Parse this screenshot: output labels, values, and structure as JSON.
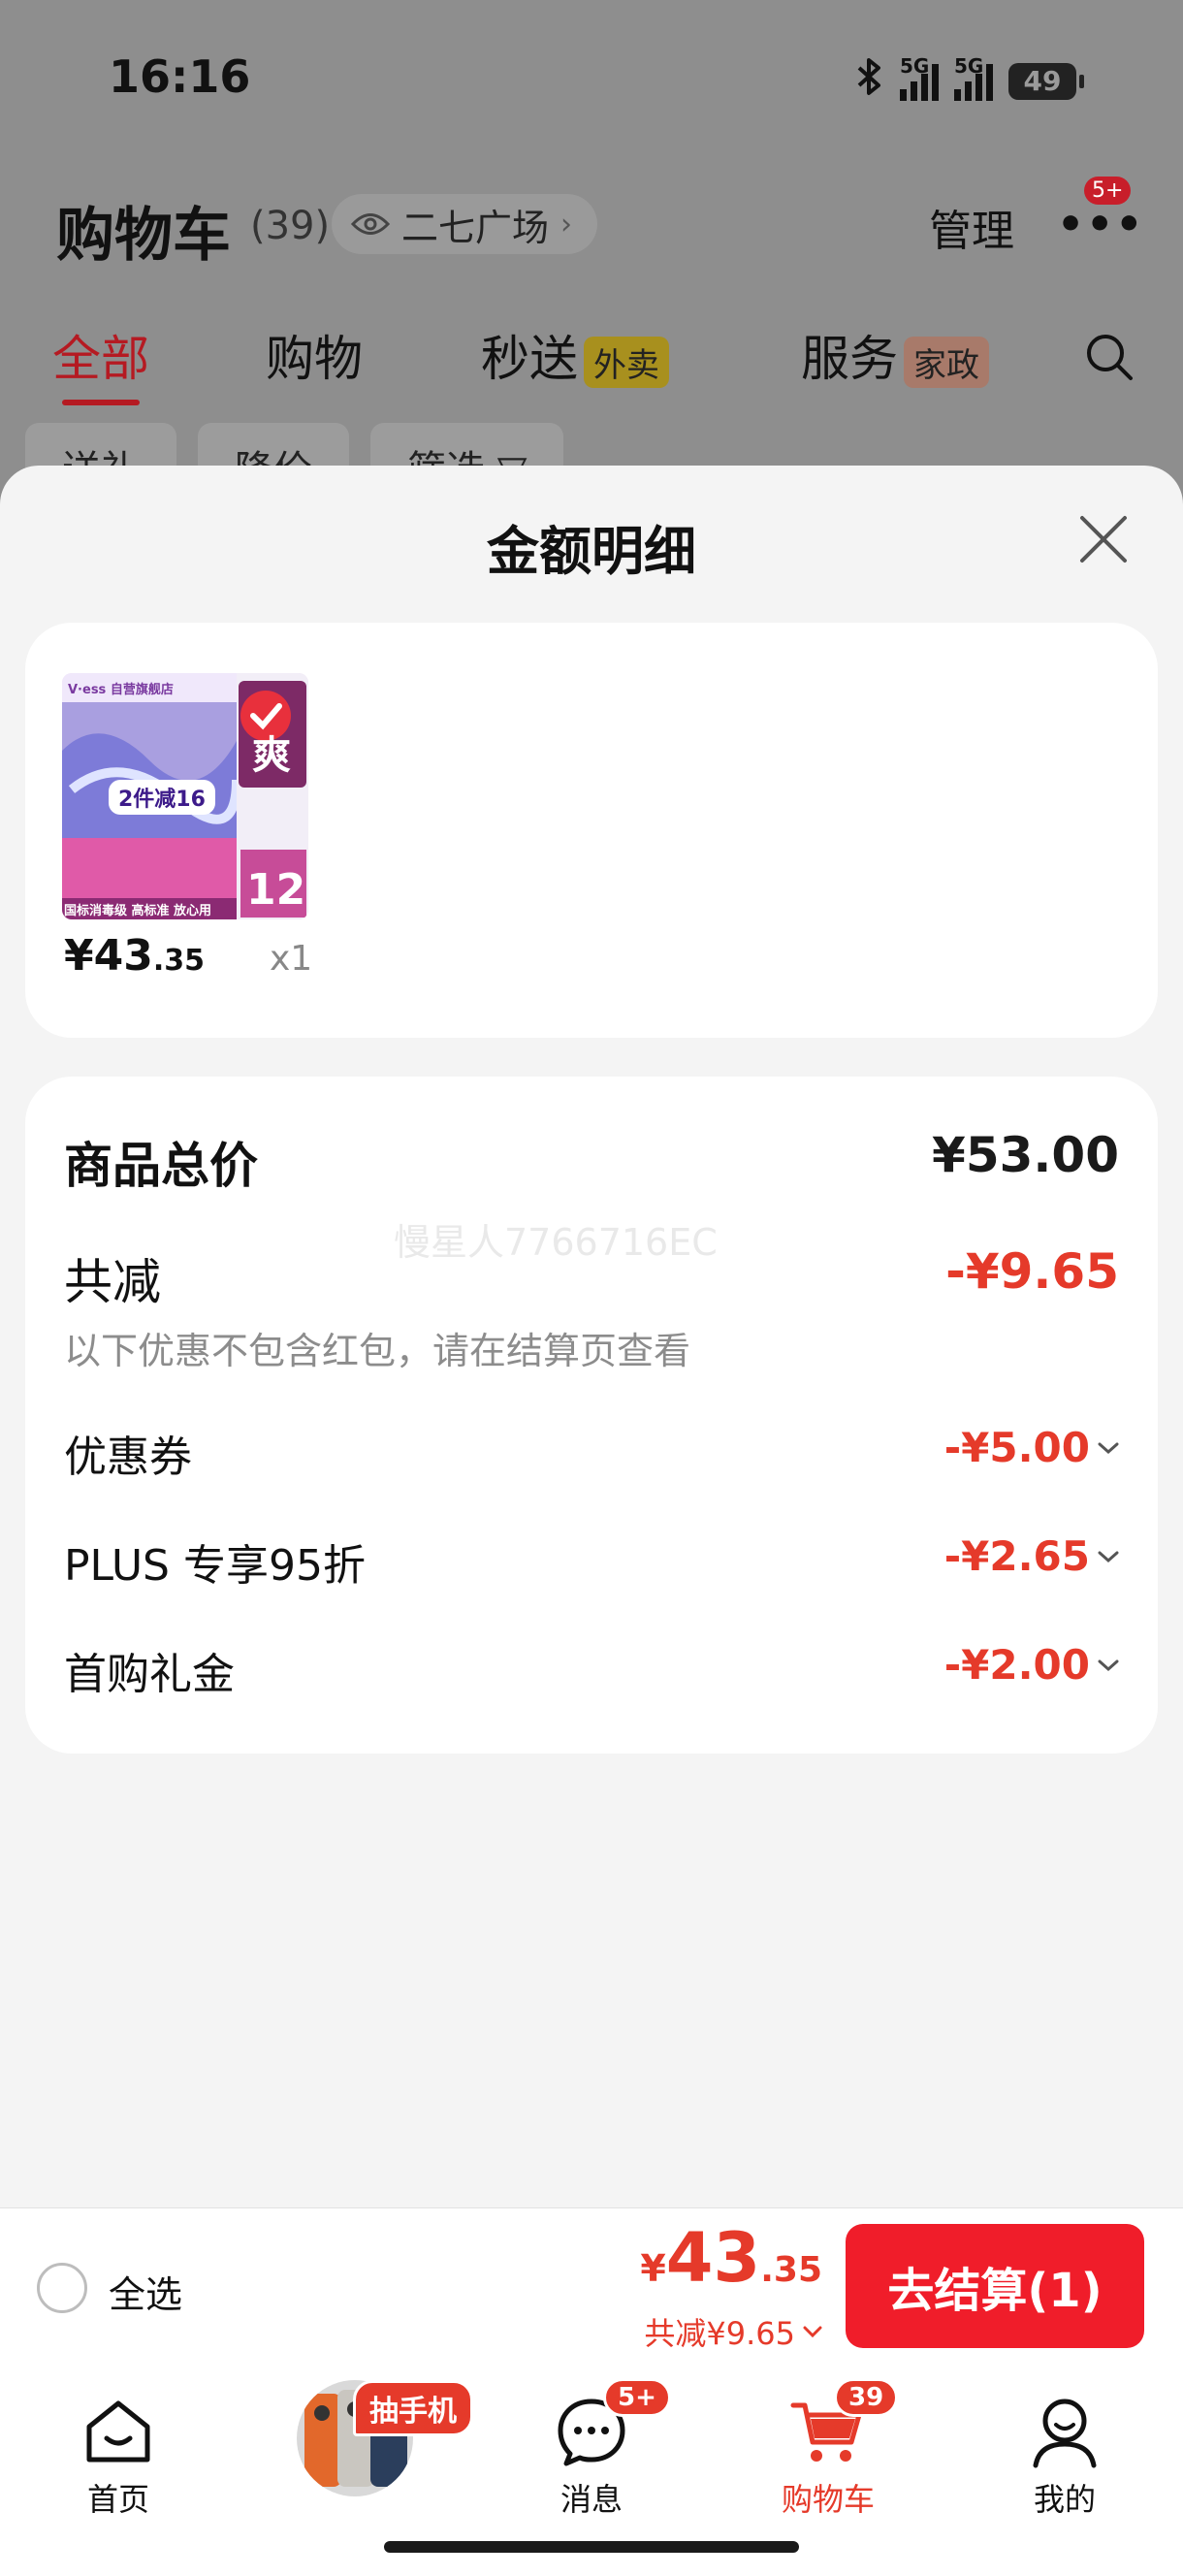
{
  "status_bar": {
    "time": "16:16",
    "net1": "5G",
    "net2": "5G",
    "battery": "49"
  },
  "header": {
    "title": "购物车",
    "count": "(39)",
    "location": "二七广场",
    "manage": "管理",
    "more_badge": "5+"
  },
  "tabs": [
    {
      "label": "全部",
      "badge": ""
    },
    {
      "label": "购物",
      "badge": ""
    },
    {
      "label": "秒送",
      "badge": "外卖"
    },
    {
      "label": "服务",
      "badge": "家政"
    }
  ],
  "chips": [
    "送礼",
    "降价",
    "筛选 ▽"
  ],
  "sheet": {
    "title": "金额明细",
    "product": {
      "thumb": {
        "shop": "V·ess 自营旗舰店",
        "promo": "2件减16",
        "count": "12",
        "slogan": "国标消毒级 高标准 放心用",
        "side": "爽"
      },
      "price_int": "¥43",
      "price_dec": ".35",
      "qty": "x1"
    },
    "detail": {
      "total_label": "商品总价",
      "total_value": "¥53.00",
      "reduce_label": "共减",
      "reduce_value": "-¥9.65",
      "note": "以下优惠不包含红包，请在结算页查看",
      "watermark": "慢星人7766716EC",
      "items": [
        {
          "label": "优惠券",
          "value": "-¥5.00"
        },
        {
          "label": "PLUS 专享95折",
          "value": "-¥2.65"
        },
        {
          "label": "首购礼金",
          "value": "-¥2.00"
        }
      ]
    }
  },
  "checkout": {
    "select_all": "全选",
    "yen": "¥",
    "total_int": "43",
    "total_dec": ".35",
    "saved": "共减¥9.65",
    "pay_button": "去结算(1)"
  },
  "tabbar": {
    "home": {
      "label": "首页"
    },
    "promo": {
      "tag": "抽手机"
    },
    "messages": {
      "label": "消息",
      "badge": "5+"
    },
    "cart": {
      "label": "购物车",
      "badge": "39"
    },
    "me": {
      "label": "我的"
    }
  },
  "colors": {
    "accent": "#e53a2a",
    "pay_button": "#f01d2a",
    "overlay": "#8e8e8e",
    "sheet_bg": "#f4f4f4"
  }
}
